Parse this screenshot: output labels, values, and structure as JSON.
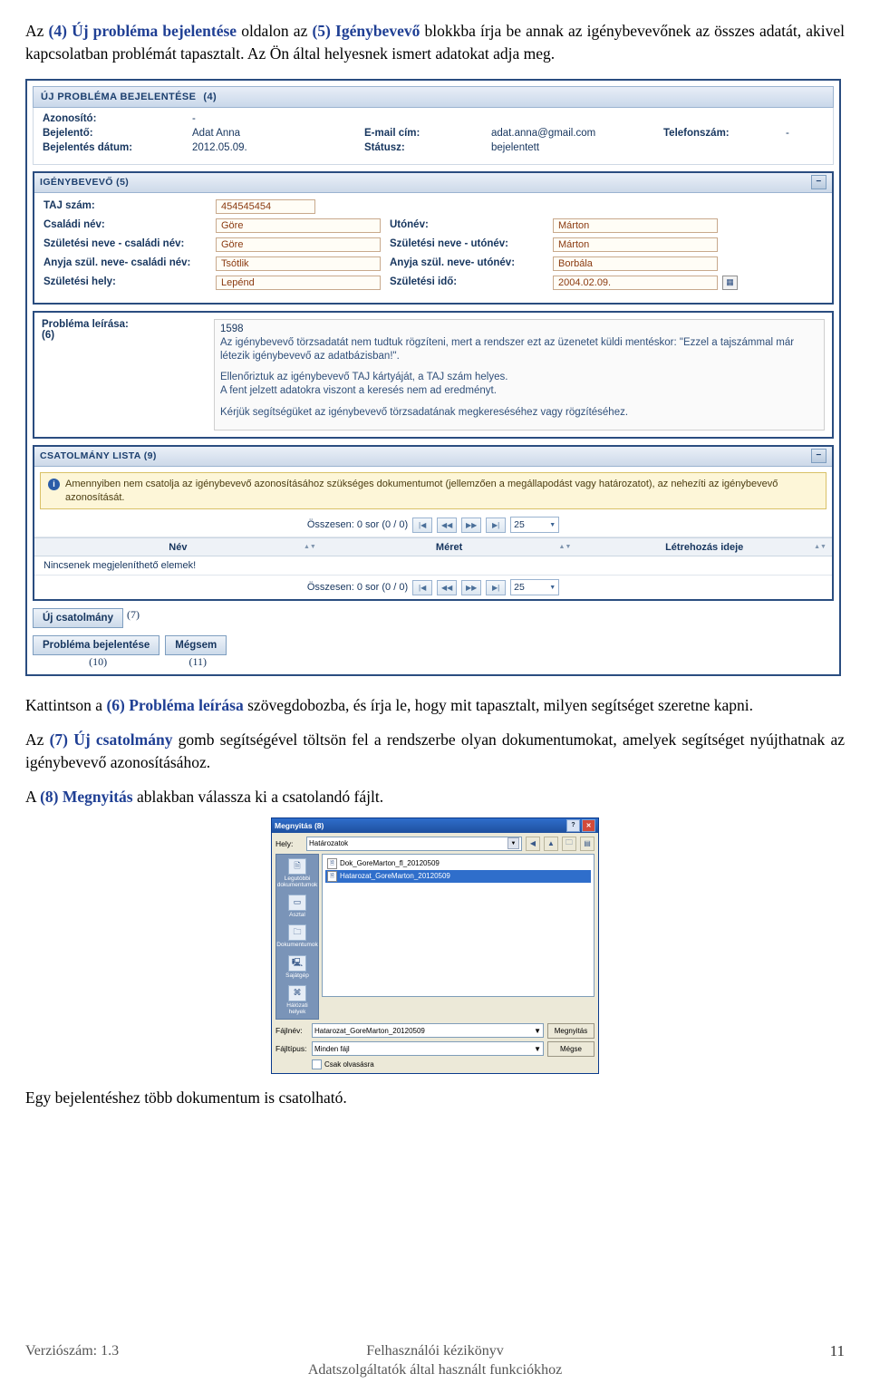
{
  "paragraphs": {
    "p1_a": "Az ",
    "p1_b": "(4) Új probléma bejelentése",
    "p1_c": " oldalon az ",
    "p1_d": "(5) Igénybevevő",
    "p1_e": " blokkba írja be annak az igénybevevőnek az összes adatát, akivel kapcsolatban problémát tapasztalt. Az Ön által helyesnek ismert adatokat adja meg.",
    "p2_a": "Kattintson a ",
    "p2_b": "(6) Probléma leírása",
    "p2_c": " szövegdobozba, és írja le, hogy mit tapasztalt, milyen segítséget szeretne kapni.",
    "p3_a": "Az ",
    "p3_b": "(7) Új csatolmány",
    "p3_c": " gomb segítségével töltsön fel a rendszerbe olyan dokumentumokat, amelyek segítséget nyújthatnak az igénybevevő azonosításához.",
    "p4_a": "A ",
    "p4_b": "(8) Megnyitás",
    "p4_c": " ablakban válassza ki a csatolandó fájlt.",
    "p5": "Egy bejelentéshez több dokumentum is csatolható."
  },
  "form": {
    "title": "ÚJ PROBLÉMA BEJELENTÉSE",
    "title_num": "(4)",
    "header": {
      "azonosito_label": "Azonosító:",
      "azonosito_value": "-",
      "bejelento_label": "Bejelentő:",
      "bejelento_value": "Adat Anna",
      "email_label": "E-mail cím:",
      "email_value": "adat.anna@gmail.com",
      "telefon_label": "Telefonszám:",
      "telefon_value": "-",
      "datum_label": "Bejelentés dátum:",
      "datum_value": "2012.05.09.",
      "statusz_label": "Státusz:",
      "statusz_value": "bejelentett"
    },
    "igenybevevo": {
      "title": "IGÉNYBEVEVŐ",
      "title_num": "(5)",
      "taj_label": "TAJ szám:",
      "taj_value": "454545454",
      "csaladi_label": "Családi név:",
      "csaladi_value": "Göre",
      "utonev_label": "Utónév:",
      "utonev_value": "Márton",
      "szul_csaladi_label": "Születési neve - családi név:",
      "szul_csaladi_value": "Göre",
      "szul_utonev_label": "Születési neve - utónév:",
      "szul_utonev_value": "Márton",
      "anyja_csaladi_label": "Anyja szül. neve- családi név:",
      "anyja_csaladi_value": "Tsótlik",
      "anyja_utonev_label": "Anyja szül. neve- utónév:",
      "anyja_utonev_value": "Borbála",
      "szul_hely_label": "Születési hely:",
      "szul_hely_value": "Lepénd",
      "szul_ido_label": "Születési idő:",
      "szul_ido_value": "2004.02.09."
    },
    "problema": {
      "label": "Probléma leírása:",
      "num": "(6)",
      "counter": "1598",
      "line1": "Az igénybevevő törzsadatát nem tudtuk rögzíteni, mert a rendszer ezt az üzenetet küldi mentéskor: \"Ezzel a tajszámmal már létezik igénybevevő az adatbázisban!\".",
      "line2": "Ellenőriztuk az igénybevevő TAJ kártyáját, a TAJ szám helyes.",
      "line3": "A fent jelzett adatokra viszont a keresés nem ad eredményt.",
      "line4": "Kérjük segítségüket az igénybevevő törzsadatának megkereséséhez vagy rögzítéséhez."
    },
    "csatolmany": {
      "title": "CSATOLMÁNY LISTA",
      "title_num": "(9)",
      "warning": "Amennyiben nem csatolja az igénybevevő azonosításához szükséges dokumentumot (jellemzően a megállapodást vagy határozatot), az nehezíti az igénybevevő azonosítását.",
      "pager_text": "Összesen: 0 sor (0 / 0)",
      "page_size": "25",
      "col_nev": "Név",
      "col_meret": "Méret",
      "col_letrehozas": "Létrehozás ideje",
      "empty_text": "Nincsenek megjeleníthető elemek!"
    },
    "buttons": {
      "uj_csatolmany": "Új csatolmány",
      "uj_csatolmany_num": "(7)",
      "bejelentes": "Probléma bejelentése",
      "bejelentes_num": "(10)",
      "megsem": "Mégsem",
      "megsem_num": "(11)"
    }
  },
  "dialog": {
    "title": "Megnyitás",
    "title_num": "(8)",
    "help_btn": "?",
    "close_btn": "✕",
    "hely_label": "Hely:",
    "hely_value": "Határozatok",
    "places": [
      {
        "label": "Legutóbbi dokumentumok",
        "icon": "recent-docs-icon"
      },
      {
        "label": "Asztal",
        "icon": "desktop-icon"
      },
      {
        "label": "Dokumentumok",
        "icon": "documents-icon"
      },
      {
        "label": "Sajátgép",
        "icon": "my-computer-icon"
      },
      {
        "label": "Hálózati helyek",
        "icon": "network-icon"
      }
    ],
    "files": [
      {
        "name": "Dok_GoreMarton_fl_20120509",
        "selected": false
      },
      {
        "name": "Hatarozat_GoreMarton_20120509",
        "selected": true
      }
    ],
    "fajlnev_label": "Fájlnév:",
    "fajlnev_value": "Hatarozat_GoreMarton_20120509",
    "fajltipus_label": "Fájltípus:",
    "fajltipus_value": "Minden fájl",
    "csak_olvasasra": "Csak olvasásra",
    "open_btn": "Megnyitás",
    "cancel_btn": "Mégse"
  },
  "footer": {
    "version": "Verziószám: 1.3",
    "center": "Felhasználói kézikönyv",
    "page": "11",
    "subtitle": "Adatszolgáltatók által használt funkciókhoz"
  }
}
